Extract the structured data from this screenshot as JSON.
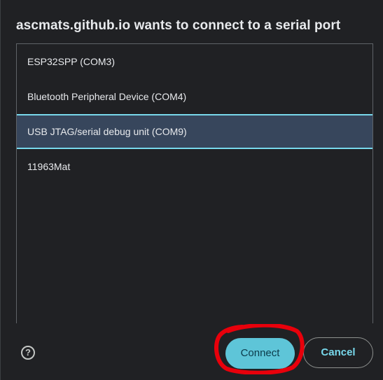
{
  "dialog": {
    "title": "ascmats.github.io wants to connect to a serial port",
    "ports": [
      {
        "label": "ESP32SPP (COM3)",
        "selected": false
      },
      {
        "label": "Bluetooth Peripheral Device (COM4)",
        "selected": false
      },
      {
        "label": "USB JTAG/serial debug unit (COM9)",
        "selected": true
      },
      {
        "label": "11963Mat",
        "selected": false
      }
    ],
    "help_symbol": "?",
    "connect_label": "Connect",
    "cancel_label": "Cancel"
  },
  "icons": {
    "help": "help-circle-icon"
  },
  "colors": {
    "background": "#202124",
    "selection_bg": "#37465c",
    "selection_border": "#78d9ec",
    "connect_bg": "#5ec5d8",
    "cancel_text": "#78d9ec",
    "annotation": "#e8000b"
  }
}
